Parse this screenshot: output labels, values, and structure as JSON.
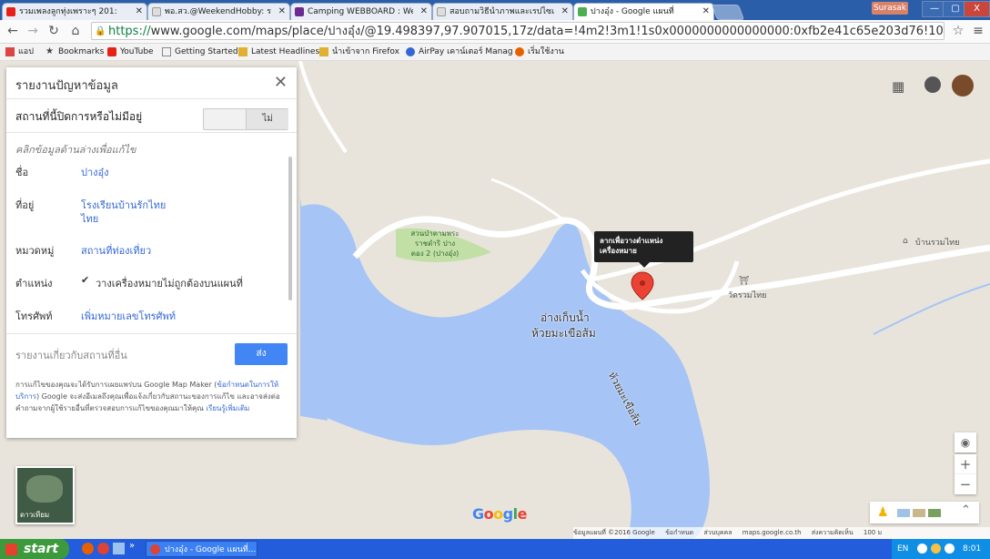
{
  "browser": {
    "tabs": [
      {
        "label": "รวมเพลงลูกทุ่งเพราะๆ 201:",
        "active": false,
        "favicon_color": "#e62117"
      },
      {
        "label": "พอ.สว.@WeekendHobby: ร",
        "active": false,
        "favicon_color": "#dddddd"
      },
      {
        "label": "Camping WEBBOARD : Weel",
        "active": false,
        "favicon_color": "#6b2c91"
      },
      {
        "label": "สอบถามวิธีนำภาพและเรปไซเ",
        "active": false,
        "favicon_color": "#dddddd"
      },
      {
        "label": "ปางอุ๋ง - Google แผนที่",
        "active": true,
        "favicon_color": "#4caf50"
      }
    ],
    "user_name": "Surasak",
    "window_controls": [
      "—",
      "▢",
      "X"
    ],
    "url_prefix": "https://",
    "url_rest": "www.google.com/maps/place/ปางอุ๋ง/@19.498397,97.907015,17z/data=!4m2!3m1!1s0x0000000000000000:0xfb2e41c65e203d76!10m2!1e1!2e1",
    "bookmarks": [
      {
        "label": "แอป",
        "icon": "apps-grid-icon",
        "color": "#d44"
      },
      {
        "label": "Bookmarks",
        "icon": "star-icon",
        "color": "#444"
      },
      {
        "label": "YouTube",
        "icon": "youtube-icon",
        "color": "#e62117"
      },
      {
        "label": "Getting Started",
        "icon": "page-icon",
        "color": "#888"
      },
      {
        "label": "Latest Headlines",
        "icon": "folder-icon",
        "color": "#e0b030"
      },
      {
        "label": "นำเข้าจาก Firefox",
        "icon": "folder-icon",
        "color": "#e0b030"
      },
      {
        "label": "AirPay เคาน์เตอร์ Manag",
        "icon": "airpay-icon",
        "color": "#3367d6"
      },
      {
        "label": "เริ่มใช้งาน",
        "icon": "firefox-icon",
        "color": "#e66000"
      }
    ]
  },
  "panel": {
    "title": "รายงานปัญหาข้อมูล",
    "closed_question": "สถานที่นี้ปิดการหรือไม่มีอยู่",
    "closed_no": "ไม่",
    "hint": "คลิกข้อมูลด้านล่างเพื่อแก้ไข",
    "rows": [
      {
        "label": "ชื่อ",
        "value": "ปางอุ๋ง"
      },
      {
        "label": "ที่อยู่",
        "value": "โรงเรียนบ้านรักไทย",
        "value2": "ไทย"
      },
      {
        "label": "หมวดหมู่",
        "value": "สถานที่ท่องเที่ยว"
      },
      {
        "label": "ตำแหน่ง",
        "value": "วางเครื่องหมายไม่ถูกต้องบนแผนที่",
        "checkbox": "✔"
      },
      {
        "label": "โทรศัพท์",
        "value": "เพิ่มหมายเลขโทรศัพท์"
      }
    ],
    "other_report": "รายงานเกี่ยวกับสถานที่อื่น",
    "send": "ส่ง",
    "legal_1": "การแก้ไขของคุณจะได้รับการเผยแพร่บน Google Map Maker (",
    "legal_link_1": "ข้อกำหนดในการให้บริการ",
    "legal_2": ") Google จะส่งอีเมลถึงคุณเพื่อแจ้งเกี่ยวกับสถานะของการแก้ไข และอาจส่งต่อคำถามจากผู้ใช้รายอื่นที่ตรวจสอบการแก้ไขของคุณมาให้คุณ ",
    "legal_link_2": "เรียนรู้เพิ่มเติม"
  },
  "map": {
    "tooltip": "ลากเพื่อวางตำแหน่งเครื่องหมาย",
    "park_label": "สวนป่าตามพระราชดำริ ปางตอง 2 (ปางอุ๋ง)",
    "reservoir_label_1": "อ่างเก็บน้ำ",
    "reservoir_label_2": "ห้วยมะเขือส้ม",
    "stream_label": "ห้วยมะเขือส้ม",
    "temple_label": "วัดรวมไทย",
    "village_label": "บ้านรวมไทย",
    "satellite_label": "ดาวเทียม",
    "google_logo": "Google",
    "attribution": [
      "ข้อมูลแผนที่ ©2016 Google",
      "ข้อกำหนด",
      "ส่วนบุคคล",
      "maps.google.co.th",
      "ส่งความคิดเห็น",
      "100 ม"
    ],
    "zoom_in": "+",
    "zoom_out": "−",
    "colors": {
      "land": "#e8e4dc",
      "water": "#a6c4f5",
      "road": "#ffffff",
      "park": "#c2dfa6",
      "pin": "#ea4335"
    }
  },
  "taskbar": {
    "start": "start",
    "task": "ปางอุ๋ง - Google แผนที่...",
    "lang": "EN",
    "clock": "8:01"
  }
}
